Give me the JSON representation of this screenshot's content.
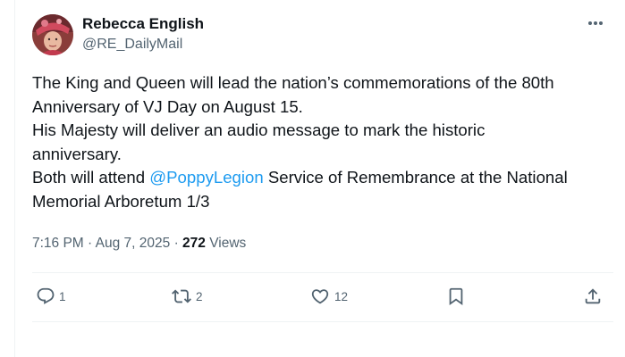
{
  "author": {
    "name": "Rebecca English",
    "handle": "@RE_DailyMail"
  },
  "tweet": {
    "line1": "The King and Queen will lead the nation’s commemorations of the 80th",
    "line2": "Anniversary of VJ Day on August 15.",
    "line3": "His Majesty will deliver an audio message to mark the historic",
    "line4": "anniversary.",
    "line5_before": "Both will attend ",
    "line5_mention": "@PoppyLegion",
    "line5_after": " Service of Remembrance at the National",
    "line6": "Memorial Arboretum 1/3"
  },
  "meta": {
    "time": "7:16 PM",
    "sep1": " · ",
    "date": "Aug 7, 2025",
    "sep2": " · ",
    "views_count": "272",
    "views_label": " Views"
  },
  "actions": {
    "replies": "1",
    "reposts": "2",
    "likes": "12"
  },
  "colors": {
    "accent": "#1d9bf0",
    "text": "#0f1419",
    "muted": "#536471",
    "divider": "#eff3f4"
  },
  "icons": [
    "more-icon",
    "reply-icon",
    "repost-icon",
    "like-icon",
    "bookmark-icon",
    "share-icon"
  ]
}
